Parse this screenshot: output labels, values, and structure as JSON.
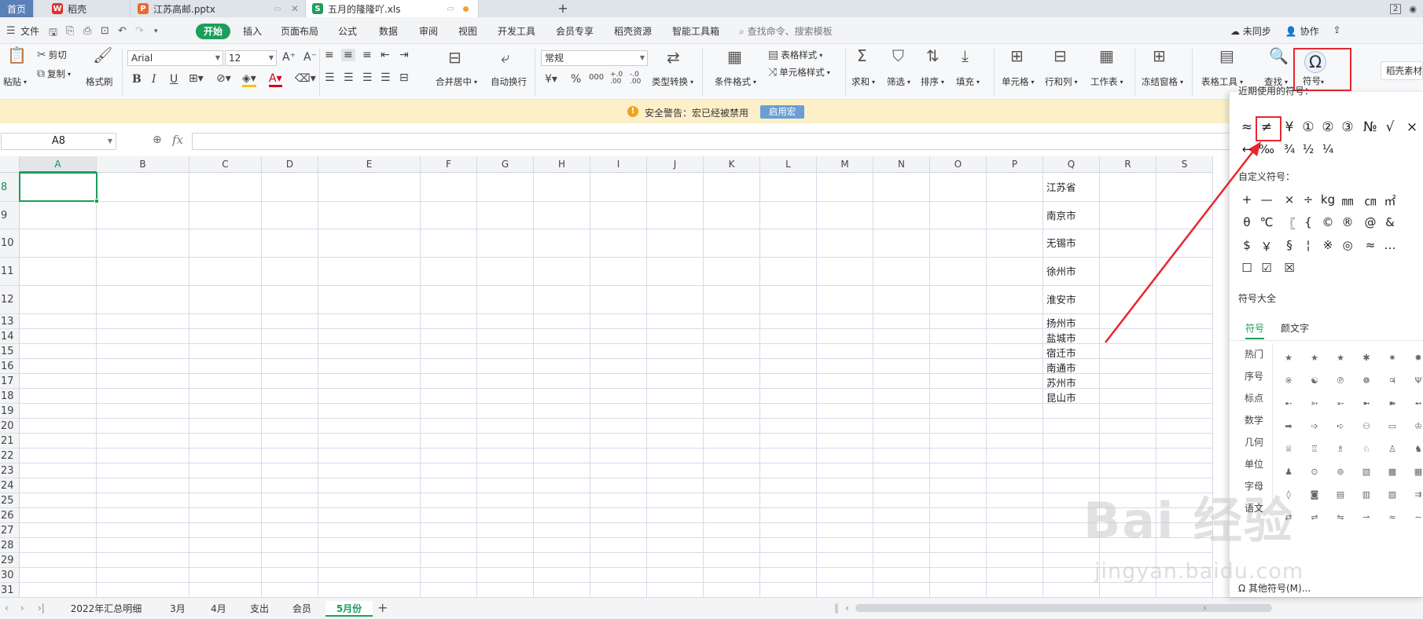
{
  "tabs": {
    "home": "首页",
    "daoke": "稻壳",
    "pptx": "江苏高邮.pptx",
    "xls": "五月的隆隆吖.xls",
    "new_tab": "+",
    "page_count": "2"
  },
  "menu": {
    "file": "文件",
    "start": "开始",
    "items": [
      "插入",
      "页面布局",
      "公式",
      "数据",
      "审阅",
      "视图",
      "开发工具",
      "会员专享",
      "稻壳资源",
      "智能工具箱"
    ],
    "search": "查找命令、搜索模板",
    "sync": "未同步",
    "collab": "协作"
  },
  "ribbon": {
    "paste": "粘贴",
    "cut": "剪切",
    "copy": "复制",
    "format_painter": "格式刷",
    "font_name": "Arial",
    "font_size": "12",
    "merge_center": "合并居中",
    "auto_wrap": "自动换行",
    "number_format": "常规",
    "type_convert": "类型转换",
    "cond_format": "条件格式",
    "table_style": "表格样式",
    "cell_style": "单元格样式",
    "sum": "求和",
    "filter": "筛选",
    "sort": "排序",
    "fill": "填充",
    "cell": "单元格",
    "row_col": "行和列",
    "worksheet": "工作表",
    "freeze": "冻结窗格",
    "table_tools": "表格工具",
    "find": "查找",
    "symbol": "符号",
    "daoke_material": "稻壳素材"
  },
  "warning": {
    "text": "安全警告：宏已经被禁用",
    "button": "启用宏"
  },
  "formula_bar": {
    "name_box": "A8",
    "fx": "fx",
    "content": ""
  },
  "grid": {
    "columns": [
      "A",
      "B",
      "C",
      "D",
      "E",
      "F",
      "G",
      "H",
      "I",
      "J",
      "K",
      "L",
      "M",
      "N",
      "O",
      "P",
      "Q",
      "R",
      "S"
    ],
    "rows": [
      "8",
      "9",
      "10",
      "11",
      "12",
      "13",
      "14",
      "15",
      "16",
      "17",
      "18",
      "19",
      "20",
      "21",
      "22",
      "23",
      "24",
      "25",
      "26",
      "27",
      "28",
      "29",
      "30",
      "31"
    ],
    "selected_cell": "A8",
    "q_values": [
      "江苏省",
      "南京市",
      "无锡市",
      "徐州市",
      "淮安市",
      "扬州市",
      "盐城市",
      "宿迁市",
      "南通市",
      "苏州市",
      "昆山市"
    ]
  },
  "sheets": {
    "tabs": [
      "2022年汇总明细",
      "3月",
      "4月",
      "支出",
      "会员",
      "5月份"
    ],
    "active": "5月份",
    "add": "+"
  },
  "symbol_panel": {
    "recent_title": "近期使用的符号：",
    "recent": [
      "≈",
      "≠",
      "¥",
      "①",
      "②",
      "③",
      "№",
      "√",
      "×",
      "←",
      "‰",
      "¾",
      "½",
      "¼"
    ],
    "custom_title": "自定义符号：",
    "custom": [
      "+",
      "—",
      "×",
      "÷",
      "kg",
      "㎜",
      "㎝",
      "㎡",
      "θ",
      "℃",
      "〖",
      "{",
      "©",
      "®",
      "@",
      "&",
      "$",
      "￥",
      "§",
      "¦",
      "※",
      "◎",
      "≈",
      "…",
      "☐",
      "☑",
      "☒"
    ],
    "all_title": "符号大全",
    "tab_symbol": "符号",
    "tab_kaomoji": "颜文字",
    "categories": [
      "热门",
      "序号",
      "标点",
      "数学",
      "几何",
      "单位",
      "字母",
      "语文"
    ],
    "more": "其他符号(M)..."
  },
  "watermark": {
    "main": "Bai 经验",
    "sub": "jingyan.baidu.com"
  },
  "colors": {
    "accent_green": "#1d9e5a",
    "highlight_red": "#e8262f",
    "warning_bg": "#fdf0c9"
  }
}
